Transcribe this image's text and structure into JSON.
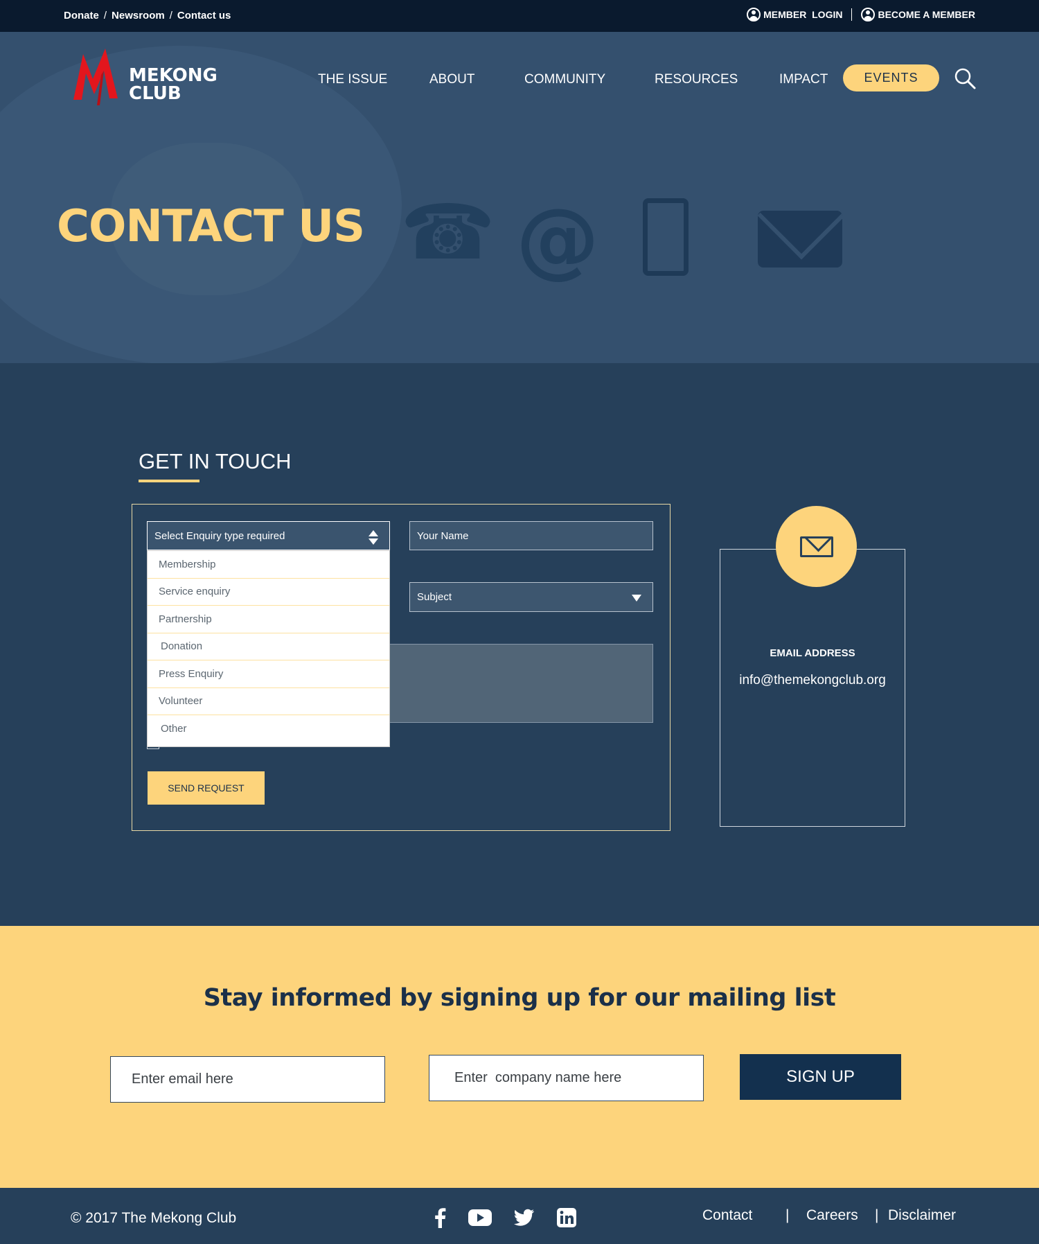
{
  "topbar": {
    "links": [
      "Donate",
      "Newsroom",
      "Contact us"
    ],
    "separator": "/",
    "member_login": "MEMBER  LOGIN",
    "become_member": "BECOME A MEMBER"
  },
  "logo": {
    "line1": "MEKONG",
    "line2": "CLUB"
  },
  "nav": {
    "items": [
      "THE ISSUE",
      "ABOUT",
      "COMMUNITY",
      "RESOURCES",
      "IMPACT"
    ],
    "events": "EVENTS"
  },
  "hero": {
    "title": "CONTACT US"
  },
  "contact": {
    "heading": "GET IN TOUCH",
    "enquiry_select": "Select Enquiry type required",
    "enquiry_options": [
      "Membership",
      "Service enquiry",
      "Partnership",
      "Donation",
      "Press Enquiry",
      "Volunteer",
      "Other"
    ],
    "name_placeholder": "Your Name",
    "subject_select": "Subject",
    "send_button": "SEND REQUEST",
    "email_label": "EMAIL ADDRESS",
    "email_value": "info@themekongclub.org"
  },
  "mailing": {
    "title": "Stay informed by signing up for our mailing list",
    "email_placeholder": "Enter email here",
    "company_placeholder": "Enter  company name here",
    "signup_button": "SIGN UP"
  },
  "footer": {
    "copyright": "© 2017 The Mekong Club",
    "social_icons": [
      "facebook-icon",
      "youtube-icon",
      "twitter-icon",
      "linkedin-icon"
    ],
    "links": [
      "Contact",
      "Careers",
      "Disclaimer"
    ],
    "separator": "|"
  },
  "colors": {
    "navy": "#26405a",
    "dark_navy": "#0a1a2e",
    "accent_yellow": "#fdd47c",
    "logo_red": "#e3161d"
  }
}
